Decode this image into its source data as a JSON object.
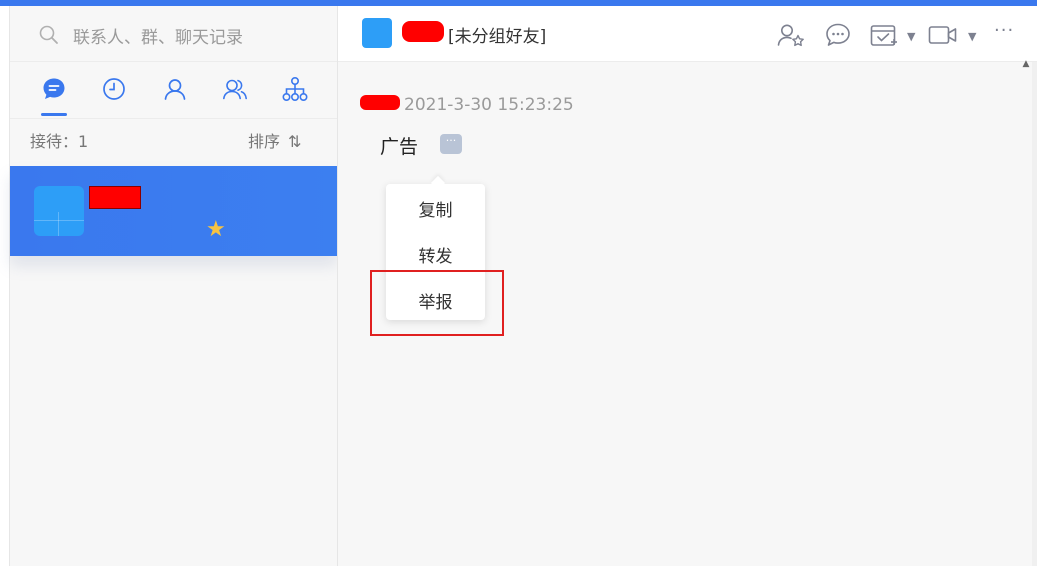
{
  "search": {
    "placeholder": "联系人、群、聊天记录",
    "icon": "search-icon"
  },
  "tabs": [
    {
      "name": "messages",
      "icon": "chat-bubble-icon",
      "active": true
    },
    {
      "name": "recent",
      "icon": "clock-icon",
      "active": false
    },
    {
      "name": "contacts",
      "icon": "person-icon",
      "active": false
    },
    {
      "name": "groups",
      "icon": "group-icon",
      "active": false
    },
    {
      "name": "organization",
      "icon": "org-tree-icon",
      "active": false
    }
  ],
  "list": {
    "reception_label": "接待：1",
    "sort_label": "排序",
    "sort_icon": "⇅"
  },
  "conversation": {
    "star": "★",
    "selected": true
  },
  "header": {
    "group_label": "[未分组好友]",
    "icons": [
      "add-friend-star-icon",
      "chat-share-icon",
      "calendar-check-icon",
      "video-call-icon",
      "more-icon"
    ],
    "more": "···"
  },
  "message": {
    "timestamp": "2021-3-30 15:23:25",
    "text": "广告",
    "more_button": "···"
  },
  "context_menu": {
    "items": [
      "复制",
      "转发",
      "举报"
    ]
  },
  "colors": {
    "accent": "#3a78ee",
    "avatar": "#2d9ef7",
    "highlight": "#e02020",
    "redaction": "#ff0000"
  }
}
